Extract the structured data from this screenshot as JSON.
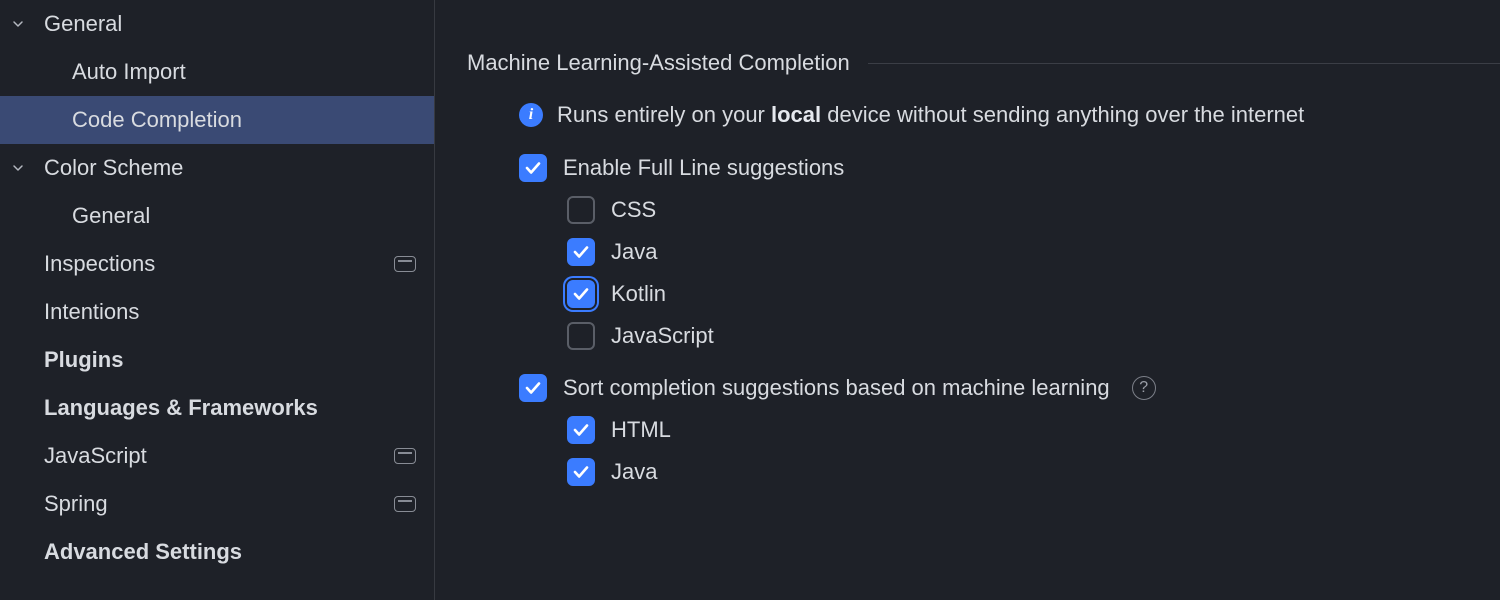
{
  "sidebar": {
    "items": [
      {
        "label": "General",
        "level": 1,
        "expandable": true,
        "expanded": true,
        "selected": false,
        "badge": false
      },
      {
        "label": "Auto Import",
        "level": 2,
        "expandable": false,
        "expanded": false,
        "selected": false,
        "badge": false
      },
      {
        "label": "Code Completion",
        "level": 2,
        "expandable": false,
        "expanded": false,
        "selected": true,
        "badge": false
      },
      {
        "label": "Color Scheme",
        "level": 1,
        "expandable": true,
        "expanded": true,
        "selected": false,
        "badge": false
      },
      {
        "label": "General",
        "level": 2,
        "expandable": false,
        "expanded": false,
        "selected": false,
        "badge": false
      },
      {
        "label": "Inspections",
        "level": 1,
        "expandable": false,
        "expanded": false,
        "selected": false,
        "badge": true
      },
      {
        "label": "Intentions",
        "level": 1,
        "expandable": false,
        "expanded": false,
        "selected": false,
        "badge": false
      },
      {
        "label": "Plugins",
        "level": 0,
        "expandable": false,
        "expanded": false,
        "selected": false,
        "badge": false
      },
      {
        "label": "Languages & Frameworks",
        "level": 0,
        "expandable": false,
        "expanded": false,
        "selected": false,
        "badge": false
      },
      {
        "label": "JavaScript",
        "level": 1,
        "expandable": false,
        "expanded": false,
        "selected": false,
        "badge": true
      },
      {
        "label": "Spring",
        "level": 1,
        "expandable": false,
        "expanded": false,
        "selected": false,
        "badge": true
      },
      {
        "label": "Advanced Settings",
        "level": 0,
        "expandable": false,
        "expanded": false,
        "selected": false,
        "badge": false
      }
    ]
  },
  "main": {
    "section_title": "Machine Learning-Assisted Completion",
    "info_pre": "Runs entirely on your ",
    "info_bold": "local",
    "info_post": " device without sending anything over the internet",
    "enable_full_line": {
      "label": "Enable Full Line suggestions",
      "checked": true,
      "focused": false
    },
    "langs": [
      {
        "label": "CSS",
        "checked": false,
        "focused": false
      },
      {
        "label": "Java",
        "checked": true,
        "focused": false
      },
      {
        "label": "Kotlin",
        "checked": true,
        "focused": true
      },
      {
        "label": "JavaScript",
        "checked": false,
        "focused": false
      }
    ],
    "sort_ml": {
      "label": "Sort completion suggestions based on machine learning",
      "checked": true,
      "focused": false,
      "help": true
    },
    "sort_langs": [
      {
        "label": "HTML",
        "checked": true,
        "focused": false
      },
      {
        "label": "Java",
        "checked": true,
        "focused": false
      }
    ]
  }
}
